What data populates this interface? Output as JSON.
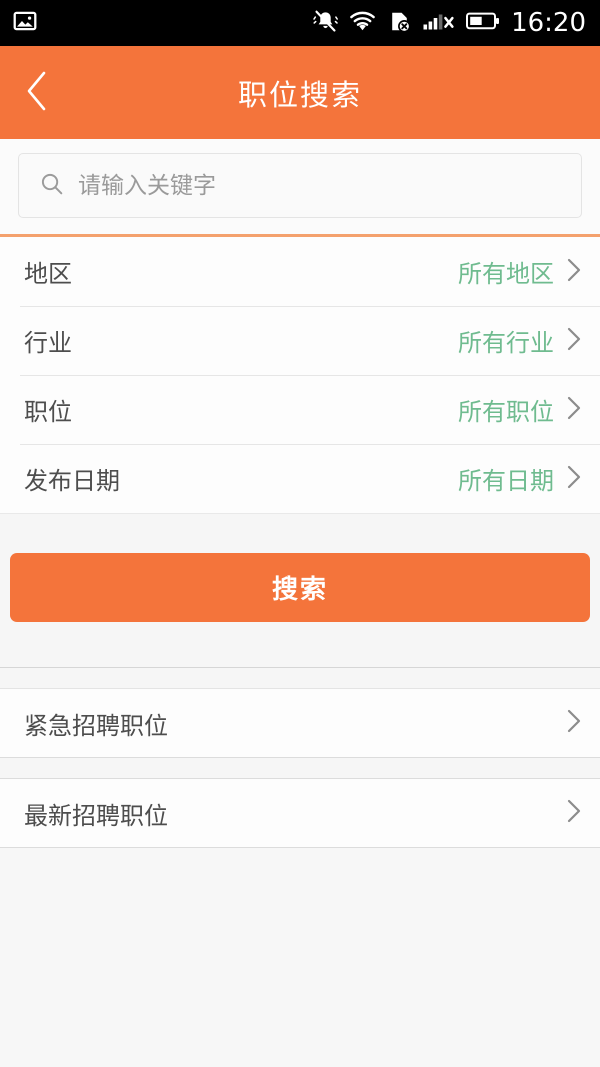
{
  "statusbar": {
    "time": "16:20",
    "icons_left": [
      "image-screenshot-icon"
    ],
    "icons_right": [
      "bell-mute-vibrate-icon",
      "wifi-icon",
      "sim-card-off-icon",
      "signal-no-service-icon",
      "battery-icon"
    ]
  },
  "header": {
    "title": "职位搜索",
    "back_icon": "chevron-left-icon",
    "background_color": "#f4743b"
  },
  "search": {
    "placeholder": "请输入关键字",
    "value": "",
    "icon": "search-icon"
  },
  "filters": [
    {
      "label": "地区",
      "value": "所有地区",
      "chevron": "chevron-right-icon"
    },
    {
      "label": "行业",
      "value": "所有行业",
      "chevron": "chevron-right-icon"
    },
    {
      "label": "职位",
      "value": "所有职位",
      "chevron": "chevron-right-icon"
    },
    {
      "label": "发布日期",
      "value": "所有日期",
      "chevron": "chevron-right-icon"
    }
  ],
  "action": {
    "search_label": "搜索",
    "button_color": "#f4743b"
  },
  "links": [
    {
      "label": "紧急招聘职位",
      "chevron": "chevron-right-icon"
    },
    {
      "label": "最新招聘职位",
      "chevron": "chevron-right-icon"
    }
  ],
  "colors": {
    "accent_orange": "#f4743b",
    "value_green": "#6fbb8f",
    "label_gray": "#4d4d4d",
    "page_bg": "#f6f6f6"
  }
}
